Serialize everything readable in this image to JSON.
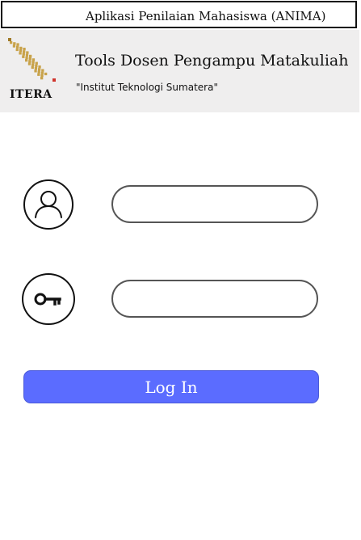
{
  "window": {
    "title": "Aplikasi Penilaian Mahasiswa (ANIMA)"
  },
  "header": {
    "logo_text": "ITERA",
    "title": "Tools Dosen Pengampu Matakuliah",
    "subtitle": "\"Institut Teknologi Sumatera\""
  },
  "login": {
    "username_icon": "user-icon",
    "password_icon": "key-icon",
    "username_value": "",
    "password_value": "",
    "button_label": "Log In"
  },
  "colors": {
    "button_bg": "#5b6cff",
    "header_bg": "#efeeee",
    "logo_gold": "#c8a24a",
    "logo_red": "#d0342c"
  }
}
